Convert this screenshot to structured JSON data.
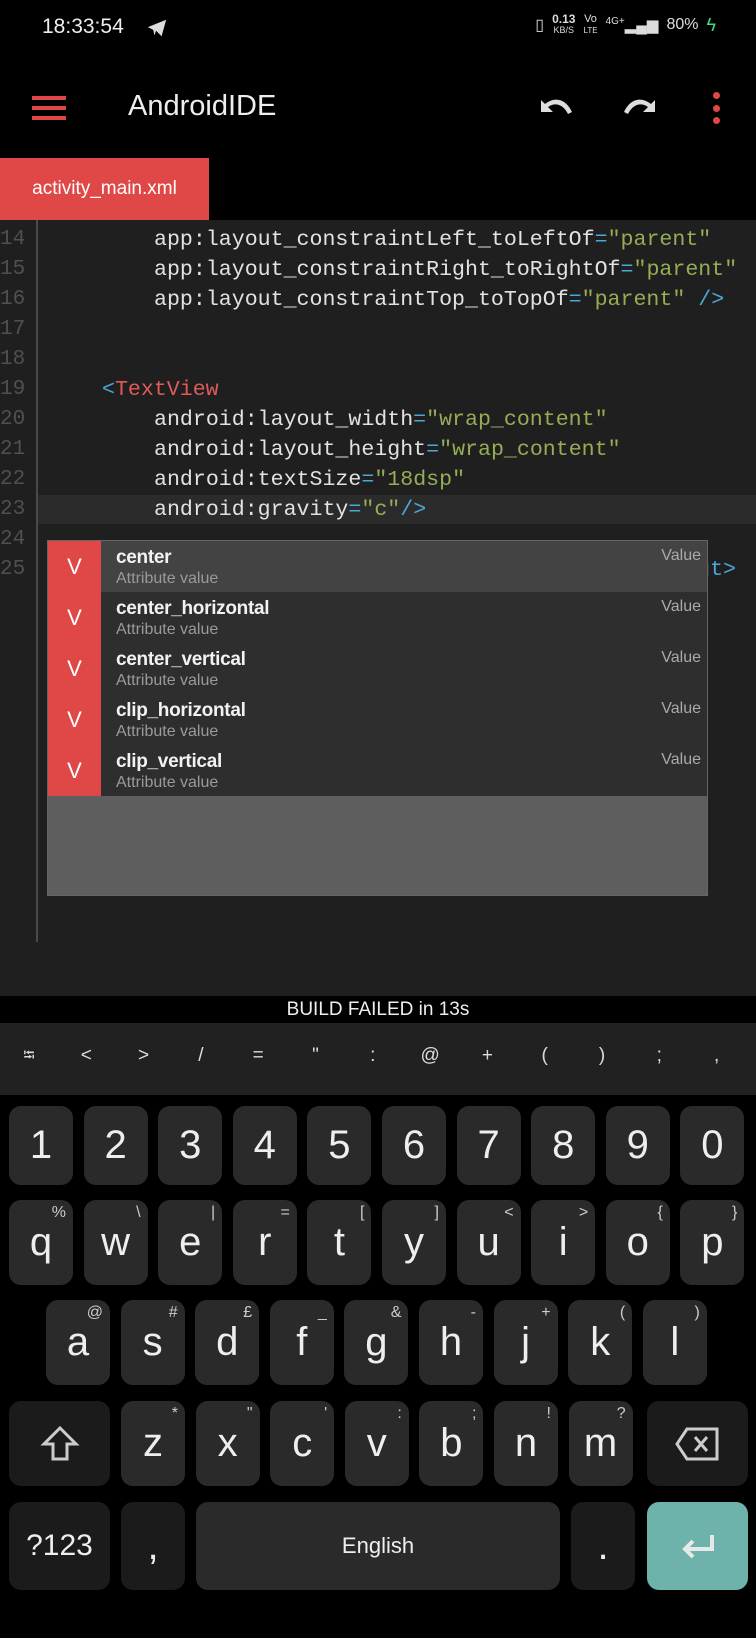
{
  "status_bar": {
    "time": "18:33:54",
    "speed_value": "0.13",
    "speed_unit": "KB/S",
    "volte_top": "Vo",
    "volte_bottom": "LTE",
    "network": "4G+",
    "battery": "80%",
    "battery_color": "#3ddc84"
  },
  "toolbar": {
    "title": "AndroidIDE",
    "accent": "#e04848"
  },
  "tabs": [
    {
      "label": "activity_main.xml",
      "active": true
    }
  ],
  "editor": {
    "current_line": 23,
    "lines": [
      {
        "n": "14",
        "indent": 12,
        "tokens": [
          [
            "attr",
            "app:layout_constraintLeft_toLeftOf"
          ],
          [
            "eq",
            "="
          ],
          [
            "str",
            "\"parent\""
          ]
        ]
      },
      {
        "n": "15",
        "indent": 12,
        "tokens": [
          [
            "attr",
            "app:layout_constraintRight_toRightOf"
          ],
          [
            "eq",
            "="
          ],
          [
            "str",
            "\"parent\""
          ]
        ]
      },
      {
        "n": "16",
        "indent": 12,
        "tokens": [
          [
            "attr",
            "app:layout_constraintTop_toTopOf"
          ],
          [
            "eq",
            "="
          ],
          [
            "str",
            "\"parent\""
          ],
          [
            "attr",
            " "
          ],
          [
            "br",
            "/>"
          ]
        ]
      },
      {
        "n": "17",
        "indent": 0,
        "tokens": []
      },
      {
        "n": "18",
        "indent": 0,
        "tokens": []
      },
      {
        "n": "19",
        "indent": 8,
        "tokens": [
          [
            "br",
            "<"
          ],
          [
            "tag",
            "TextView"
          ]
        ]
      },
      {
        "n": "20",
        "indent": 12,
        "tokens": [
          [
            "attr",
            "android:layout_width"
          ],
          [
            "eq",
            "="
          ],
          [
            "str",
            "\"wrap_content\""
          ]
        ]
      },
      {
        "n": "21",
        "indent": 12,
        "tokens": [
          [
            "attr",
            "android:layout_height"
          ],
          [
            "eq",
            "="
          ],
          [
            "str",
            "\"wrap_content\""
          ]
        ]
      },
      {
        "n": "22",
        "indent": 12,
        "tokens": [
          [
            "attr",
            "android:textSize"
          ],
          [
            "eq",
            "="
          ],
          [
            "str",
            "\"18dsp\""
          ]
        ]
      },
      {
        "n": "23",
        "indent": 12,
        "tokens": [
          [
            "attr",
            "android:gravity"
          ],
          [
            "eq",
            "="
          ],
          [
            "str",
            "\"c\""
          ],
          [
            "br",
            "/>"
          ]
        ]
      },
      {
        "n": "24",
        "indent": 0,
        "tokens": []
      },
      {
        "n": "25",
        "indent": 0,
        "tokens": []
      }
    ],
    "line25_tail": "ut>"
  },
  "completion": {
    "items": [
      {
        "kind": "V",
        "label": "center",
        "detail": "Attribute value",
        "type": "Value",
        "selected": true
      },
      {
        "kind": "V",
        "label": "center_horizontal",
        "detail": "Attribute value",
        "type": "Value"
      },
      {
        "kind": "V",
        "label": "center_vertical",
        "detail": "Attribute value",
        "type": "Value"
      },
      {
        "kind": "V",
        "label": "clip_horizontal",
        "detail": "Attribute value",
        "type": "Value"
      },
      {
        "kind": "V",
        "label": "clip_vertical",
        "detail": "Attribute value",
        "type": "Value"
      }
    ]
  },
  "build_status": "BUILD FAILED in 13s",
  "symbols": [
    "⭾",
    "<",
    ">",
    "/",
    "=",
    "\"",
    ":",
    "@",
    "+",
    "(",
    ")",
    ";",
    ","
  ],
  "keyboard": {
    "numbers": [
      "1",
      "2",
      "3",
      "4",
      "5",
      "6",
      "7",
      "8",
      "9",
      "0"
    ],
    "row1": [
      [
        "q",
        "%"
      ],
      [
        "w",
        "\\"
      ],
      [
        "e",
        "|"
      ],
      [
        "r",
        "="
      ],
      [
        "t",
        "["
      ],
      [
        "y",
        "]"
      ],
      [
        "u",
        "<"
      ],
      [
        "i",
        ">"
      ],
      [
        "o",
        "{"
      ],
      [
        "p",
        "}"
      ]
    ],
    "row2": [
      [
        "a",
        "@"
      ],
      [
        "s",
        "#"
      ],
      [
        "d",
        "£"
      ],
      [
        "f",
        "_"
      ],
      [
        "g",
        "&"
      ],
      [
        "h",
        "-"
      ],
      [
        "j",
        "+"
      ],
      [
        "k",
        "("
      ],
      [
        "l",
        ")"
      ]
    ],
    "row3": [
      [
        "z",
        "*"
      ],
      [
        "x",
        "\""
      ],
      [
        "c",
        "'"
      ],
      [
        "v",
        ":"
      ],
      [
        "b",
        ";"
      ],
      [
        "n",
        "!"
      ],
      [
        "m",
        "?"
      ]
    ],
    "symbols_key": "?123",
    "comma": ",",
    "space": "English",
    "period": ".",
    "enter_color": "#6db3ac"
  }
}
